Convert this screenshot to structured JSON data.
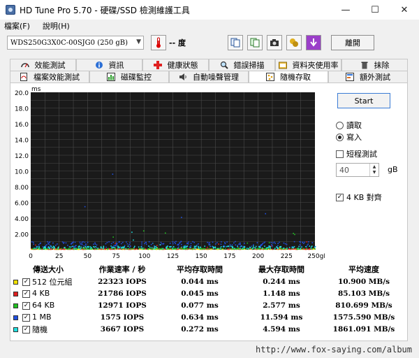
{
  "window": {
    "title": "HD Tune Pro 5.70 - 硬碟/SSD 檢測維護工具",
    "minimize_glyph": "—",
    "maximize_glyph": "☐",
    "close_glyph": "✕"
  },
  "menu": {
    "items": [
      "檔案(F)",
      "說明(H)"
    ]
  },
  "toolbar": {
    "drive": "WDS250G3X0C-00SJG0 (250 gB)",
    "temperature": "-- 度",
    "exit_label": "離開"
  },
  "tabs": {
    "row1": [
      {
        "label": "效能測試",
        "icon": "gauge-icon"
      },
      {
        "label": "資訊",
        "icon": "info-icon"
      },
      {
        "label": "健康狀態",
        "icon": "health-cross-icon"
      },
      {
        "label": "錯誤掃描",
        "icon": "magnifier-icon"
      },
      {
        "label": "資料夾使用率",
        "icon": "folder-icon"
      },
      {
        "label": "抹除",
        "icon": "trash-icon"
      }
    ],
    "row2": [
      {
        "label": "檔案效能測試",
        "icon": "file-benchmark-icon"
      },
      {
        "label": "磁碟監控",
        "icon": "monitor-chart-icon"
      },
      {
        "label": "自動噪聲管理",
        "icon": "speaker-icon"
      },
      {
        "label": "隨機存取",
        "icon": "random-access-icon",
        "active": true
      },
      {
        "label": "額外測試",
        "icon": "extra-tests-icon"
      }
    ]
  },
  "controls": {
    "start_label": "Start",
    "read_label": "讀取",
    "write_label": "寫入",
    "selected_mode": "write",
    "short_test_label": "短程測試",
    "short_test_checked": false,
    "size_value": "40",
    "size_unit": "gB",
    "align_label": "4 KB 對齊",
    "align_checked": true
  },
  "chart_data": {
    "type": "scatter",
    "ylabel": "ms",
    "ylim": [
      0,
      20
    ],
    "xlim": [
      0,
      250
    ],
    "y_ticks": [
      "2.00",
      "4.00",
      "6.00",
      "8.00",
      "10.0",
      "12.0",
      "14.0",
      "16.0",
      "18.0",
      "20.0"
    ],
    "x_ticks": [
      "0",
      "25",
      "50",
      "75",
      "100",
      "125",
      "150",
      "175",
      "200",
      "225",
      "250gB"
    ],
    "grid": true,
    "series": [
      {
        "name": "512 位元組",
        "color": "#f0e000",
        "typical_ms": 0.044,
        "max_ms": 0.244
      },
      {
        "name": "4 KB",
        "color": "#e02020",
        "typical_ms": 0.045,
        "max_ms": 1.148
      },
      {
        "name": "64 KB",
        "color": "#20c020",
        "typical_ms": 0.077,
        "max_ms": 2.577
      },
      {
        "name": "1 MB",
        "color": "#2050e0",
        "typical_ms": 0.634,
        "max_ms": 11.594
      },
      {
        "name": "隨機",
        "color": "#20e0e0",
        "typical_ms": 0.272,
        "max_ms": 4.594
      }
    ]
  },
  "results": {
    "headers": [
      "傳送大小",
      "作業速率 / 秒",
      "平均存取時間",
      "最大存取時間",
      "平均速度"
    ],
    "rows": [
      {
        "name": "512 位元組",
        "color": "#f0e000",
        "iops": "22323 IOPS",
        "avg": "0.044 ms",
        "max": "0.244 ms",
        "speed": "10.900 MB/s"
      },
      {
        "name": "4 KB",
        "color": "#e02020",
        "iops": "21786 IOPS",
        "avg": "0.045 ms",
        "max": "1.148 ms",
        "speed": "85.103 MB/s"
      },
      {
        "name": "64 KB",
        "color": "#20c020",
        "iops": "12971 IOPS",
        "avg": "0.077 ms",
        "max": "2.577 ms",
        "speed": "810.699 MB/s"
      },
      {
        "name": "1 MB",
        "color": "#2050e0",
        "iops": "1575 IOPS",
        "avg": "0.634 ms",
        "max": "11.594 ms",
        "speed": "1575.590 MB/s"
      },
      {
        "name": "隨機",
        "color": "#20e0e0",
        "iops": "3667 IOPS",
        "avg": "0.272 ms",
        "max": "4.594 ms",
        "speed": "1861.091 MB/s"
      }
    ]
  },
  "footer": {
    "watermark": "http://www.fox-saying.com/album"
  }
}
